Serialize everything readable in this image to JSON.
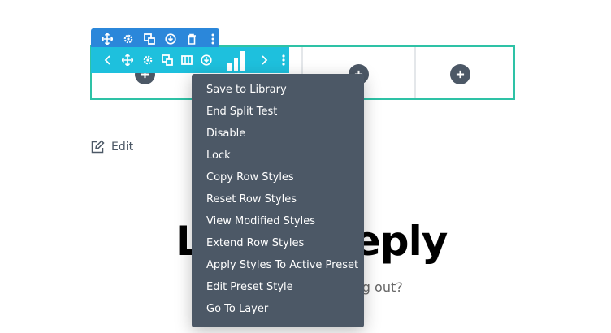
{
  "background": {
    "title_left": "L",
    "title_right": "eply",
    "subtitle_fragment": "og out?"
  },
  "edit": {
    "label": "Edit"
  },
  "section_toolbar": {
    "icons": [
      "move-icon",
      "gear-icon",
      "duplicate-icon",
      "save-icon",
      "delete-icon",
      "more-icon"
    ]
  },
  "row_toolbar": {
    "icons": [
      "chevron-left-icon",
      "move-icon",
      "gear-icon",
      "duplicate-icon",
      "columns-icon",
      "save-icon",
      "split-test-stats-icon",
      "chevron-right-icon",
      "more-icon"
    ]
  },
  "context_menu": {
    "items": [
      "Save to Library",
      "End Split Test",
      "Disable",
      "Lock",
      "Copy Row Styles",
      "Reset Row Styles",
      "View Modified Styles",
      "Extend Row Styles",
      "Apply Styles To Active Preset",
      "Edit Preset Style",
      "Go To Layer"
    ]
  },
  "colors": {
    "section_toolbar": "#2b87da",
    "row_toolbar": "#1ec0dd",
    "row_outline": "#2ec2a6",
    "menu_bg": "#4c5866"
  }
}
